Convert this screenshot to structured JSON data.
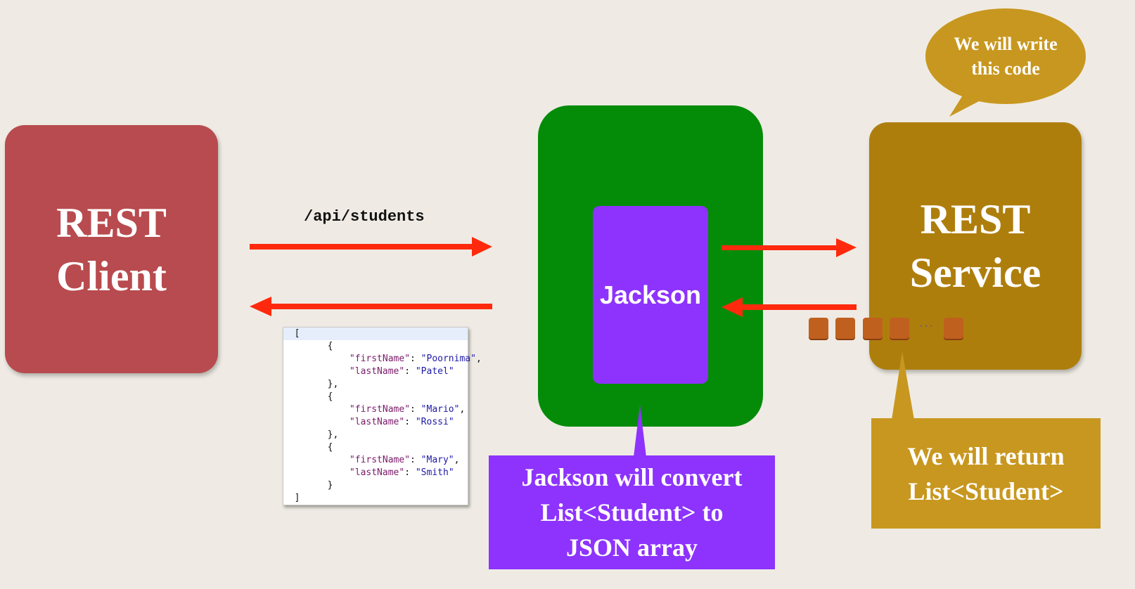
{
  "client": {
    "line1": "REST",
    "line2": "Client"
  },
  "service": {
    "line1": "REST",
    "line2": "Service"
  },
  "jackson": {
    "label": "Jackson"
  },
  "request": {
    "endpoint": "/api/students"
  },
  "json_response": {
    "lines": [
      {
        "indent": 0,
        "text": "["
      },
      {
        "indent": 1,
        "text": "{"
      },
      {
        "indent": 2,
        "key": "\"firstName\"",
        "value": "\"Poornima\"",
        "end": ","
      },
      {
        "indent": 2,
        "key": "\"lastName\"",
        "value": "\"Patel\"",
        "end": ""
      },
      {
        "indent": 1,
        "text": "},"
      },
      {
        "indent": 1,
        "text": "{"
      },
      {
        "indent": 2,
        "key": "\"firstName\"",
        "value": "\"Mario\"",
        "end": ","
      },
      {
        "indent": 2,
        "key": "\"lastName\"",
        "value": "\"Rossi\"",
        "end": ""
      },
      {
        "indent": 1,
        "text": "},"
      },
      {
        "indent": 1,
        "text": "{"
      },
      {
        "indent": 2,
        "key": "\"firstName\"",
        "value": "\"Mary\"",
        "end": ","
      },
      {
        "indent": 2,
        "key": "\"lastName\"",
        "value": "\"Smith\"",
        "end": ""
      },
      {
        "indent": 1,
        "text": "}"
      },
      {
        "indent": 0,
        "text": "]"
      }
    ]
  },
  "callouts": {
    "jackson_note": {
      "line1": "Jackson will convert",
      "line2": "List<Student> to",
      "line3": "JSON array"
    },
    "return_note": {
      "line1": "We will return",
      "line2": "List<Student>"
    },
    "write_note": {
      "line1": "We will write",
      "line2": "this code"
    }
  },
  "list_items": {
    "ellipsis": "···"
  },
  "colors": {
    "client": "#b84b4f",
    "service": "#ae7e0d",
    "jackson_outer": "#048c09",
    "jackson_inner": "#8d33fd",
    "arrow": "#ff2a0d",
    "callout_gold": "#c8971f",
    "list_item": "#c0601f"
  }
}
